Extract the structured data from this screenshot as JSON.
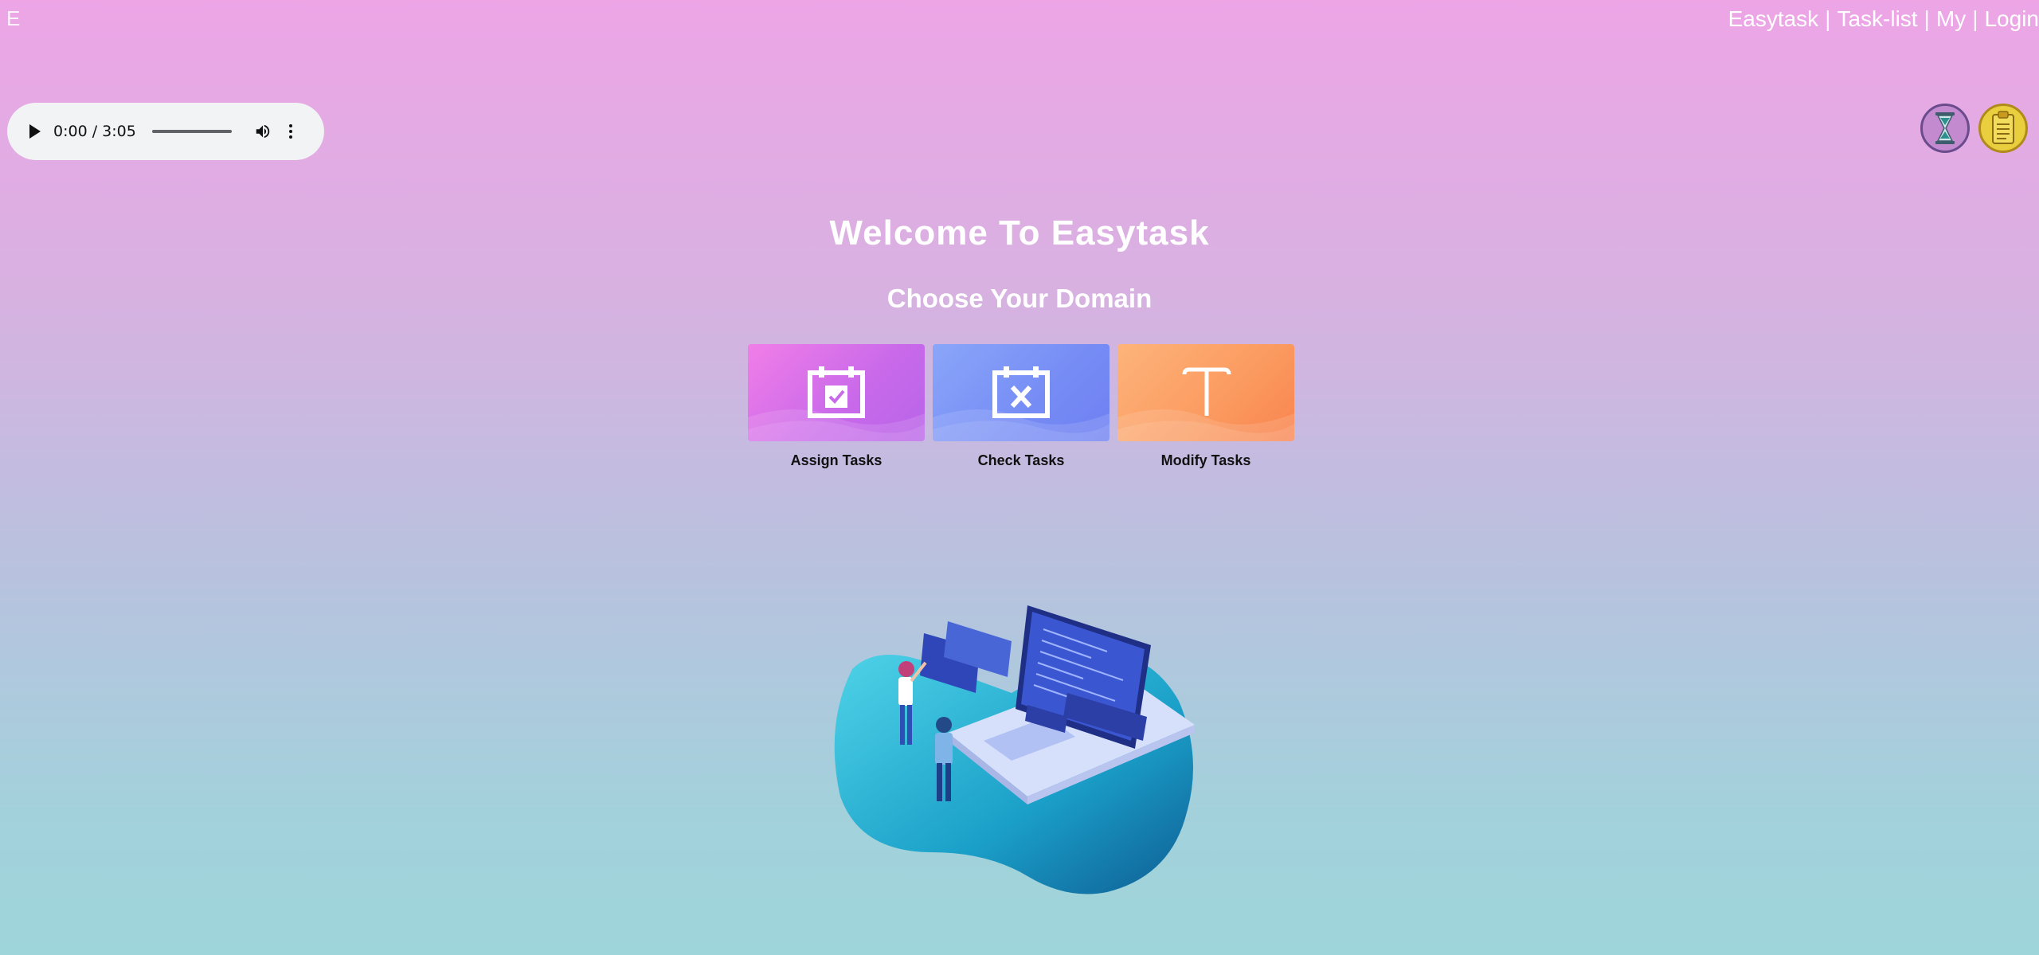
{
  "brand": {
    "corner_letter": "E"
  },
  "nav": {
    "items": [
      {
        "label": "Easytask"
      },
      {
        "label": "Task-list"
      },
      {
        "label": "My"
      },
      {
        "label": "Login"
      }
    ],
    "separator": "|"
  },
  "audio": {
    "time": "0:00 / 3:05",
    "progress": 0,
    "volume": 1.0
  },
  "top_buttons": [
    {
      "icon": "hourglass-icon",
      "color": "#c48ad0"
    },
    {
      "icon": "clipboard-icon",
      "color": "#e9cf3d"
    }
  ],
  "main": {
    "title": "Welcome To Easytask",
    "subtitle": "Choose Your Domain"
  },
  "domains": [
    {
      "label": "Assign Tasks",
      "icon": "calendar-check-icon",
      "color": "#d36bea"
    },
    {
      "label": "Check Tasks",
      "icon": "calendar-x-icon",
      "color": "#7a8ff6"
    },
    {
      "label": "Modify Tasks",
      "icon": "text-cursor-icon",
      "color": "#fb9a60"
    }
  ],
  "colors": {
    "background_top": "#eda5e6",
    "background_bottom": "#9dd5da",
    "text": "#ffffff"
  }
}
